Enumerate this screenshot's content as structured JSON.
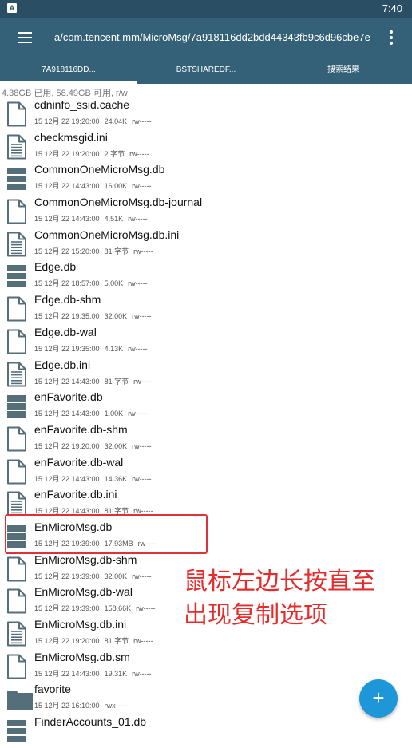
{
  "status_bar": {
    "app_badge": "A",
    "time": "7:40"
  },
  "app_bar": {
    "path": "a/com.tencent.mm/MicroMsg/7a918116dd2bdd44343fb9c6d96cbe7e"
  },
  "tabs": [
    {
      "label": "7A918116DD..."
    },
    {
      "label": "BSTSHAREDF..."
    },
    {
      "label": "搜索结果"
    }
  ],
  "storage_info": "4.38GB 已用, 58.49GB 可用, r/w",
  "files": [
    {
      "name": "cdninfo_ssid.cache",
      "date": "15 12月 22 19:20:00",
      "size": "24.04K",
      "perm": "rw-----",
      "icon": "file-icon"
    },
    {
      "name": "checkmsgid.ini",
      "date": "15 12月 22 19:20:00",
      "size": "2 字节",
      "perm": "rw-----",
      "icon": "text-file-icon"
    },
    {
      "name": "CommonOneMicroMsg.db",
      "date": "15 12月 22 14:43:00",
      "size": "16.00K",
      "perm": "rw-----",
      "icon": "database-icon"
    },
    {
      "name": "CommonOneMicroMsg.db-journal",
      "date": "15 12月 22 14:43:00",
      "size": "4.51K",
      "perm": "rw-----",
      "icon": "file-icon"
    },
    {
      "name": "CommonOneMicroMsg.db.ini",
      "date": "15 12月 22 15:20:00",
      "size": "81 字节",
      "perm": "rw-----",
      "icon": "text-file-icon"
    },
    {
      "name": "Edge.db",
      "date": "15 12月 22 18:57:00",
      "size": "5.00K",
      "perm": "rw-----",
      "icon": "database-icon"
    },
    {
      "name": "Edge.db-shm",
      "date": "15 12月 22 19:35:00",
      "size": "32.00K",
      "perm": "rw-----",
      "icon": "file-icon"
    },
    {
      "name": "Edge.db-wal",
      "date": "15 12月 22 19:35:00",
      "size": "4.13K",
      "perm": "rw-----",
      "icon": "file-icon"
    },
    {
      "name": "Edge.db.ini",
      "date": "15 12月 22 14:43:00",
      "size": "81 字节",
      "perm": "rw-----",
      "icon": "text-file-icon"
    },
    {
      "name": "enFavorite.db",
      "date": "15 12月 22 14:43:00",
      "size": "1.00K",
      "perm": "rw-----",
      "icon": "database-icon"
    },
    {
      "name": "enFavorite.db-shm",
      "date": "15 12月 22 19:20:00",
      "size": "32.00K",
      "perm": "rw-----",
      "icon": "file-icon"
    },
    {
      "name": "enFavorite.db-wal",
      "date": "15 12月 22 14:43:00",
      "size": "14.36K",
      "perm": "rw-----",
      "icon": "file-icon"
    },
    {
      "name": "enFavorite.db.ini",
      "date": "15 12月 22 14:43:00",
      "size": "81 字节",
      "perm": "rw-----",
      "icon": "text-file-icon"
    },
    {
      "name": "EnMicroMsg.db",
      "date": "15 12月 22 19:39:00",
      "size": "17.93MB",
      "perm": "rw-----",
      "icon": "database-icon"
    },
    {
      "name": "EnMicroMsg.db-shm",
      "date": "15 12月 22 19:39:00",
      "size": "32.00K",
      "perm": "rw-----",
      "icon": "file-icon"
    },
    {
      "name": "EnMicroMsg.db-wal",
      "date": "15 12月 22 19:39:00",
      "size": "158.66K",
      "perm": "rw-----",
      "icon": "file-icon"
    },
    {
      "name": "EnMicroMsg.db.ini",
      "date": "15 12月 22 19:20:00",
      "size": "81 字节",
      "perm": "rw-----",
      "icon": "text-file-icon"
    },
    {
      "name": "EnMicroMsg.db.sm",
      "date": "15 12月 22 14:43:00",
      "size": "19.31K",
      "perm": "rw-----",
      "icon": "file-icon"
    },
    {
      "name": "favorite",
      "date": "15 12月 22 16:10:00",
      "size": "",
      "perm": "rwx-----",
      "icon": "folder-icon"
    },
    {
      "name": "FinderAccounts_01.db",
      "date": "",
      "size": "",
      "perm": "",
      "icon": "database-icon"
    }
  ],
  "annotation": {
    "line1": "鼠标左边长按直至",
    "line2": "出现复制选项"
  },
  "fab": {
    "label": "+"
  },
  "colors": {
    "app_bar": "#346078",
    "status_bar": "#2a4e63",
    "accent": "#1d97d8",
    "annotation": "#e52b2b"
  }
}
